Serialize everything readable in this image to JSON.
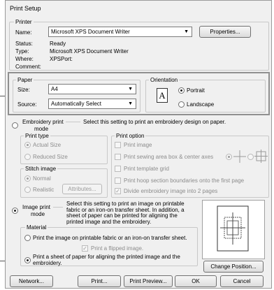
{
  "window": {
    "title": "Print Setup"
  },
  "printer": {
    "group_label": "Printer",
    "name_label": "Name:",
    "name_value": "Microsoft XPS Document Writer",
    "properties_button": "Properties...",
    "status_label": "Status:",
    "status_value": "Ready",
    "type_label": "Type:",
    "type_value": "Microsoft XPS Document Writer",
    "where_label": "Where:",
    "where_value": "XPSPort:",
    "comment_label": "Comment:"
  },
  "paper": {
    "group_label": "Paper",
    "size_label": "Size:",
    "size_value": "A4",
    "source_label": "Source:",
    "source_value": "Automatically Select"
  },
  "orientation": {
    "group_label": "Orientation",
    "icon_letter": "A",
    "portrait_label": "Portrait",
    "landscape_label": "Landscape",
    "selected": "Portrait"
  },
  "embroidery_mode": {
    "label_line1": "Embroidery print",
    "label_line2": "mode",
    "description": "Select this setting to print an embroidery design on paper.",
    "print_type": {
      "group_label": "Print type",
      "actual_size": "Actual Size",
      "reduced_size": "Reduced Size"
    },
    "stitch_image": {
      "group_label": "Stitch image",
      "normal": "Normal",
      "realistic": "Realistic",
      "attributes_button": "Attributes..."
    },
    "print_option": {
      "group_label": "Print option",
      "print_image": "Print image",
      "print_sewing_area": "Print sewing area box & center axes",
      "print_template_grid": "Print template grid",
      "print_hoop_section": "Print hoop section boundaries onto the first page",
      "divide_embroidery": "Divide embroidery image into 2 pages"
    }
  },
  "image_mode": {
    "label_line1": "Image print",
    "label_line2": "mode",
    "description": "Select this setting to print an image on printable fabric or an iron-on transfer sheet. In addition, a sheet of paper can be printed for aligning the printed image and the embroidery.",
    "material": {
      "group_label": "Material",
      "option1": "Print the image on printable fabric or an iron-on transfer sheet.",
      "print_flipped": "Print a flipped image.",
      "option2": "Print a sheet of paper for aligning the printed image and the embroidery."
    },
    "change_position_button": "Change Position..."
  },
  "buttons": {
    "network": "Network...",
    "print": "Print...",
    "print_preview": "Print Preview...",
    "ok": "OK",
    "cancel": "Cancel"
  }
}
